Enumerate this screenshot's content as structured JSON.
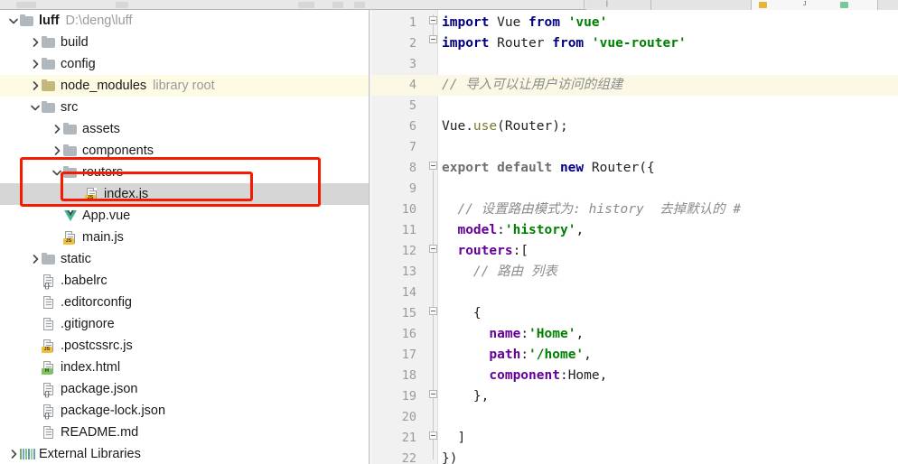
{
  "toolbar": {
    "tabs": [
      {
        "label": "",
        "icon": "js-file-icon",
        "active": false
      },
      {
        "label": "",
        "icon": "vue-file-icon",
        "active": true
      },
      {
        "label": "",
        "icon": "html-file-icon",
        "active": false
      }
    ]
  },
  "tree": {
    "root_label": "luff",
    "root_path": "D:\\deng\\luff",
    "items": [
      {
        "label": "luff",
        "sub": "D:\\deng\\luff",
        "icon": "folder-icon",
        "indent": 0,
        "twisty": "down",
        "bold": true,
        "highlight": "none"
      },
      {
        "label": "build",
        "sub": "",
        "icon": "folder-icon",
        "indent": 1,
        "twisty": "right",
        "bold": false,
        "highlight": "none"
      },
      {
        "label": "config",
        "sub": "",
        "icon": "folder-icon",
        "indent": 1,
        "twisty": "right",
        "bold": false,
        "highlight": "none"
      },
      {
        "label": "node_modules",
        "sub": "library root",
        "icon": "folder-library-icon",
        "indent": 1,
        "twisty": "right",
        "bold": false,
        "highlight": "yellow"
      },
      {
        "label": "src",
        "sub": "",
        "icon": "folder-icon",
        "indent": 1,
        "twisty": "down",
        "bold": false,
        "highlight": "none"
      },
      {
        "label": "assets",
        "sub": "",
        "icon": "folder-icon",
        "indent": 2,
        "twisty": "right",
        "bold": false,
        "highlight": "none"
      },
      {
        "label": "components",
        "sub": "",
        "icon": "folder-icon",
        "indent": 2,
        "twisty": "right",
        "bold": false,
        "highlight": "none"
      },
      {
        "label": "routers",
        "sub": "",
        "icon": "folder-icon",
        "indent": 2,
        "twisty": "down",
        "bold": false,
        "highlight": "none"
      },
      {
        "label": "index.js",
        "sub": "",
        "icon": "js-file-icon",
        "indent": 3,
        "twisty": "none",
        "bold": false,
        "highlight": "selected"
      },
      {
        "label": "App.vue",
        "sub": "",
        "icon": "vue-file-icon",
        "indent": 2,
        "twisty": "none",
        "bold": false,
        "highlight": "none"
      },
      {
        "label": "main.js",
        "sub": "",
        "icon": "js-file-icon",
        "indent": 2,
        "twisty": "none",
        "bold": false,
        "highlight": "none"
      },
      {
        "label": "static",
        "sub": "",
        "icon": "folder-icon",
        "indent": 1,
        "twisty": "right",
        "bold": false,
        "highlight": "none"
      },
      {
        "label": ".babelrc",
        "sub": "",
        "icon": "json-file-icon",
        "indent": 1,
        "twisty": "none",
        "bold": false,
        "highlight": "none"
      },
      {
        "label": ".editorconfig",
        "sub": "",
        "icon": "text-file-icon",
        "indent": 1,
        "twisty": "none",
        "bold": false,
        "highlight": "none"
      },
      {
        "label": ".gitignore",
        "sub": "",
        "icon": "text-file-icon",
        "indent": 1,
        "twisty": "none",
        "bold": false,
        "highlight": "none"
      },
      {
        "label": ".postcssrc.js",
        "sub": "",
        "icon": "js-file-icon",
        "indent": 1,
        "twisty": "none",
        "bold": false,
        "highlight": "none"
      },
      {
        "label": "index.html",
        "sub": "",
        "icon": "html-file-icon",
        "indent": 1,
        "twisty": "none",
        "bold": false,
        "highlight": "none"
      },
      {
        "label": "package.json",
        "sub": "",
        "icon": "json-file-icon",
        "indent": 1,
        "twisty": "none",
        "bold": false,
        "highlight": "none"
      },
      {
        "label": "package-lock.json",
        "sub": "",
        "icon": "json-file-icon",
        "indent": 1,
        "twisty": "none",
        "bold": false,
        "highlight": "none"
      },
      {
        "label": "README.md",
        "sub": "",
        "icon": "text-file-icon",
        "indent": 1,
        "twisty": "none",
        "bold": false,
        "highlight": "none"
      },
      {
        "label": "External Libraries",
        "sub": "",
        "icon": "libraries-icon",
        "indent": 0,
        "twisty": "right",
        "bold": false,
        "highlight": "none"
      }
    ]
  },
  "annotations": [
    {
      "name": "routers-folder-callout",
      "color": "#f61b00"
    },
    {
      "name": "index-js-callout",
      "color": "#f61b00"
    }
  ],
  "editor": {
    "highlighted_line": 4,
    "lines": [
      {
        "n": 1,
        "tokens": [
          {
            "t": "import",
            "c": "kw"
          },
          {
            "t": " Vue ",
            "c": "pl"
          },
          {
            "t": "from",
            "c": "kw"
          },
          {
            "t": " ",
            "c": "pl"
          },
          {
            "t": "'vue'",
            "c": "str"
          }
        ]
      },
      {
        "n": 2,
        "tokens": [
          {
            "t": "import",
            "c": "kw"
          },
          {
            "t": " Router ",
            "c": "pl"
          },
          {
            "t": "from",
            "c": "kw"
          },
          {
            "t": " ",
            "c": "pl"
          },
          {
            "t": "'vue-router'",
            "c": "str"
          }
        ]
      },
      {
        "n": 3,
        "tokens": []
      },
      {
        "n": 4,
        "tokens": [
          {
            "t": "// 导入可以让用户访问的组建",
            "c": "cmt"
          }
        ]
      },
      {
        "n": 5,
        "tokens": []
      },
      {
        "n": 6,
        "tokens": [
          {
            "t": "Vue.",
            "c": "pl"
          },
          {
            "t": "use",
            "c": "fn"
          },
          {
            "t": "(Router);",
            "c": "pl"
          }
        ]
      },
      {
        "n": 7,
        "tokens": []
      },
      {
        "n": 8,
        "tokens": [
          {
            "t": "export default ",
            "c": "kwd"
          },
          {
            "t": "new",
            "c": "kw"
          },
          {
            "t": " Router({",
            "c": "pl"
          }
        ]
      },
      {
        "n": 9,
        "tokens": []
      },
      {
        "n": 10,
        "tokens": [
          {
            "t": "  // 设置路由模式为: history  去掉默认的 #",
            "c": "cmt"
          }
        ]
      },
      {
        "n": 11,
        "tokens": [
          {
            "t": "  ",
            "c": "pl"
          },
          {
            "t": "model",
            "c": "prop"
          },
          {
            "t": ":",
            "c": "pl"
          },
          {
            "t": "'history'",
            "c": "str"
          },
          {
            "t": ",",
            "c": "pl"
          }
        ]
      },
      {
        "n": 12,
        "tokens": [
          {
            "t": "  ",
            "c": "pl"
          },
          {
            "t": "routers",
            "c": "prop"
          },
          {
            "t": ":[",
            "c": "pl"
          }
        ]
      },
      {
        "n": 13,
        "tokens": [
          {
            "t": "    // 路由 列表",
            "c": "cmt"
          }
        ]
      },
      {
        "n": 14,
        "tokens": []
      },
      {
        "n": 15,
        "tokens": [
          {
            "t": "    {",
            "c": "pl"
          }
        ]
      },
      {
        "n": 16,
        "tokens": [
          {
            "t": "      ",
            "c": "pl"
          },
          {
            "t": "name",
            "c": "prop"
          },
          {
            "t": ":",
            "c": "pl"
          },
          {
            "t": "'Home'",
            "c": "str"
          },
          {
            "t": ",",
            "c": "pl"
          }
        ]
      },
      {
        "n": 17,
        "tokens": [
          {
            "t": "      ",
            "c": "pl"
          },
          {
            "t": "path",
            "c": "prop"
          },
          {
            "t": ":",
            "c": "pl"
          },
          {
            "t": "'/home'",
            "c": "str"
          },
          {
            "t": ",",
            "c": "pl"
          }
        ]
      },
      {
        "n": 18,
        "tokens": [
          {
            "t": "      ",
            "c": "pl"
          },
          {
            "t": "component",
            "c": "prop"
          },
          {
            "t": ":Home,",
            "c": "pl"
          }
        ]
      },
      {
        "n": 19,
        "tokens": [
          {
            "t": "    },",
            "c": "pl"
          }
        ]
      },
      {
        "n": 20,
        "tokens": []
      },
      {
        "n": 21,
        "tokens": [
          {
            "t": "  ]",
            "c": "pl"
          }
        ]
      },
      {
        "n": 22,
        "tokens": [
          {
            "t": "})",
            "c": "pl"
          }
        ]
      }
    ]
  }
}
